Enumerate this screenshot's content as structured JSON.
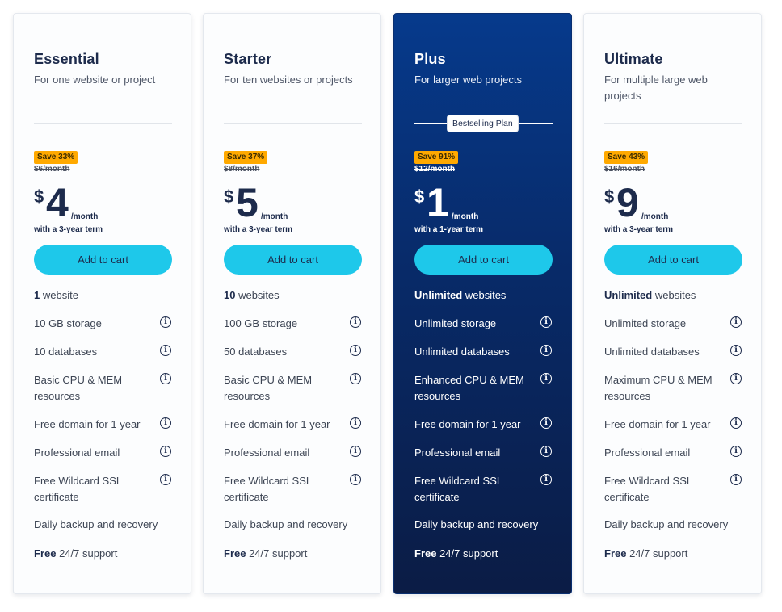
{
  "plans": [
    {
      "name": "Essential",
      "subtitle": "For one website or project",
      "save": "Save 33%",
      "old_price": "$6/month",
      "currency": "$",
      "price": "4",
      "per": "/month",
      "term": "with a 3-year term",
      "cta": "Add to cart",
      "features": [
        {
          "bold": "1",
          "text": " website"
        },
        {
          "text": "10 GB storage"
        },
        {
          "text": "10 databases"
        },
        {
          "text": "Basic CPU & MEM resources"
        },
        {
          "text": "Free domain for 1 year"
        },
        {
          "text": "Professional email"
        },
        {
          "text": "Free Wildcard SSL certificate"
        },
        {
          "text": "Daily backup and recovery"
        },
        {
          "bold": "Free",
          "text": " 24/7 support"
        }
      ]
    },
    {
      "name": "Starter",
      "subtitle": "For ten websites or projects",
      "save": "Save 37%",
      "old_price": "$8/month",
      "currency": "$",
      "price": "5",
      "per": "/month",
      "term": "with a 3-year term",
      "cta": "Add to cart",
      "features": [
        {
          "bold": "10",
          "text": " websites"
        },
        {
          "text": "100 GB storage"
        },
        {
          "text": "50 databases"
        },
        {
          "text": "Basic CPU & MEM resources"
        },
        {
          "text": "Free domain for 1 year"
        },
        {
          "text": "Professional email"
        },
        {
          "text": "Free Wildcard SSL certificate"
        },
        {
          "text": "Daily backup and recovery"
        },
        {
          "bold": "Free",
          "text": " 24/7 support"
        }
      ]
    },
    {
      "name": "Plus",
      "subtitle": "For larger web projects",
      "badge": "Bestselling Plan",
      "save": "Save 91%",
      "old_price": "$12/month",
      "currency": "$",
      "price": "1",
      "per": "/month",
      "term": "with a 1-year term",
      "cta": "Add to cart",
      "features": [
        {
          "bold": "Unlimited",
          "text": " websites"
        },
        {
          "text": "Unlimited storage"
        },
        {
          "text": "Unlimited databases"
        },
        {
          "text": "Enhanced CPU & MEM resources"
        },
        {
          "text": "Free domain for 1 year"
        },
        {
          "text": "Professional email"
        },
        {
          "text": "Free Wildcard SSL certificate"
        },
        {
          "text": "Daily backup and recovery"
        },
        {
          "bold": "Free",
          "text": " 24/7 support"
        }
      ]
    },
    {
      "name": "Ultimate",
      "subtitle": "For multiple large web projects",
      "save": "Save 43%",
      "old_price": "$16/month",
      "currency": "$",
      "price": "9",
      "per": "/month",
      "term": "with a 3-year term",
      "cta": "Add to cart",
      "features": [
        {
          "bold": "Unlimited",
          "text": " websites"
        },
        {
          "text": "Unlimited storage"
        },
        {
          "text": "Unlimited databases"
        },
        {
          "text": "Maximum CPU & MEM resources"
        },
        {
          "text": "Free domain for 1 year"
        },
        {
          "text": "Professional email"
        },
        {
          "text": "Free Wildcard SSL certificate"
        },
        {
          "text": "Daily backup and recovery"
        },
        {
          "bold": "Free",
          "text": " 24/7 support"
        }
      ]
    }
  ],
  "info_icon_glyph": "i",
  "colors": {
    "accent_button": "#1ec8ea",
    "save_badge": "#ffa900",
    "featured_top": "#063a8c",
    "featured_bottom": "#0b1c45",
    "heading": "#1d2b4c"
  }
}
